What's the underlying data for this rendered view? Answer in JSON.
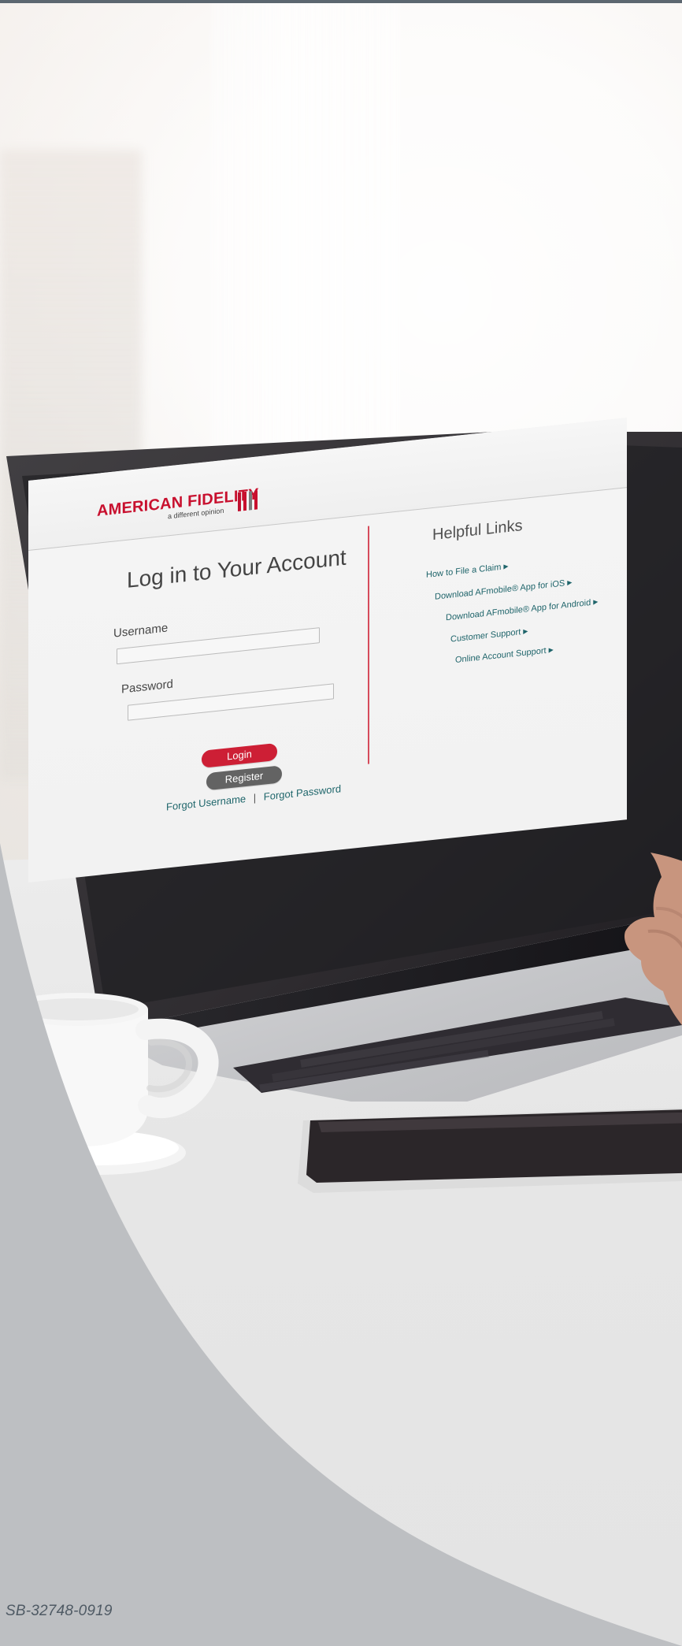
{
  "screen": {
    "brand": {
      "name": "AMERICAN FIDELITY",
      "tagline": "a different opinion"
    },
    "login": {
      "title": "Log in to Your Account",
      "username_label": "Username",
      "username_value": "",
      "password_label": "Password",
      "password_value": "",
      "login_button": "Login",
      "register_button": "Register",
      "forgot_username": "Forgot Username",
      "separator": "|",
      "forgot_password": "Forgot Password"
    },
    "helpful_links": {
      "title": "Helpful Links",
      "items": [
        "How to File a Claim",
        "Download AFmobile® App for iOS",
        "Download AFmobile® App for Android",
        "Customer Support",
        "Online Account Support"
      ]
    }
  },
  "footer": {
    "code": "SB-32748-0919"
  },
  "colors": {
    "brand_red": "#c8102e",
    "link_teal": "#1e646a",
    "overlay_gray": "#bdbfc2",
    "code_gray": "#4f5a64"
  },
  "icons": {
    "logo_mark": "stripes-logo-icon",
    "link_arrow": "arrow-right-icon"
  }
}
